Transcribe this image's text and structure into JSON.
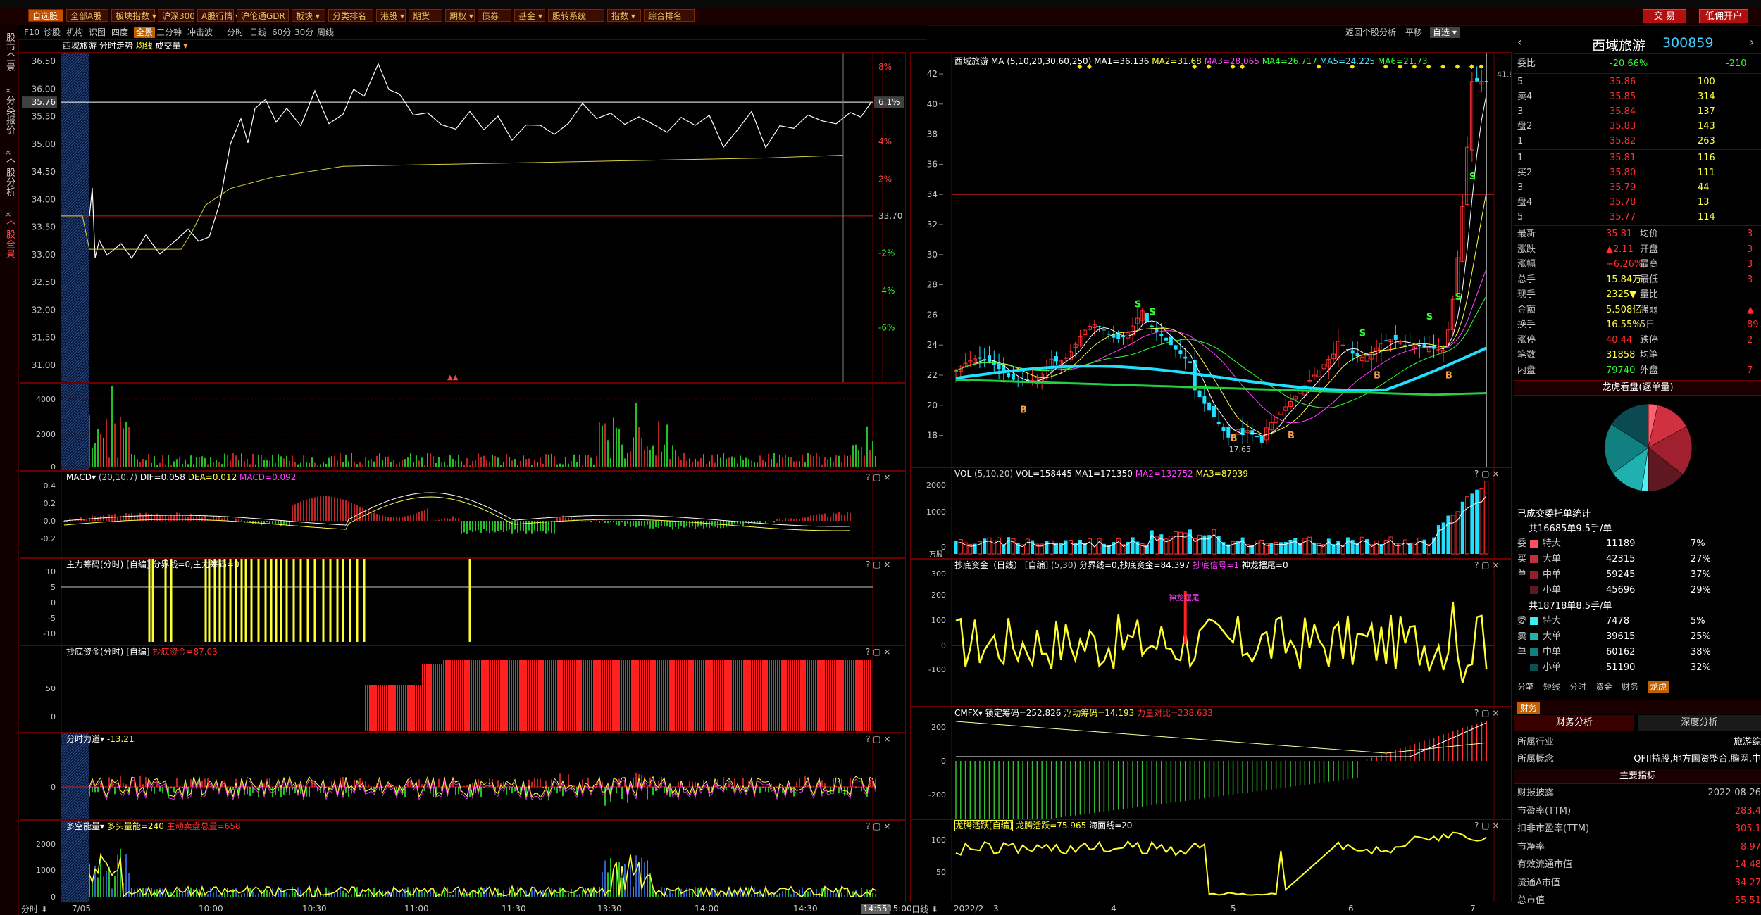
{
  "menubar": {
    "buttons": [
      "自选股",
      "全部A股",
      "板块指数",
      "沪深300",
      "A股行情",
      "沪伦通GDR",
      "板块",
      "分类排名",
      "港股",
      "期货",
      "期权",
      "债券",
      "基金",
      "股转系统",
      "指数",
      "综合排名"
    ],
    "trade_label": "交 易",
    "open_account_label": "低佣开户"
  },
  "sidebar": {
    "tabs": [
      "股市全景",
      "分类报价",
      "个股分析",
      "个股全景"
    ]
  },
  "intraday_toolbar": {
    "items": [
      "F10",
      "诊股",
      "机构",
      "识图",
      "四度",
      "全景",
      "三分钟",
      "冲击波",
      "分时",
      "日线",
      "60分",
      "30分",
      "周线"
    ],
    "active": "全景"
  },
  "kline_toolbar": {
    "items": [
      "返回个股分析",
      "平移",
      "自选"
    ]
  },
  "intraday": {
    "title_name": "西域旅游",
    "title_chart": "分时走势",
    "title_avg": "均线",
    "title_vol": "成交量",
    "price_ticks": [
      "36.50",
      "36.00",
      "35.76",
      "35.50",
      "35.00",
      "34.50",
      "34.00",
      "33.50",
      "33.00",
      "32.50",
      "32.00",
      "31.50",
      "31.00"
    ],
    "current_price": "35.76",
    "pct_ticks": [
      "8%",
      "6.1%",
      "4%",
      "2%",
      "33.70",
      "-2%",
      "-4%",
      "-6%"
    ],
    "vol_ticks": [
      "4000",
      "2000",
      "0"
    ],
    "time_labels": [
      "7/05",
      "10:00",
      "10:30",
      "11:00",
      "11:30",
      "13:30",
      "14:00",
      "14:30",
      "14:55",
      "15:00"
    ],
    "bottom_left": "分时",
    "indicators": {
      "macd": {
        "name": "MACD",
        "params": "(20,10,7)",
        "dif": "DIF=0.058",
        "dea": "DEA=0.012",
        "macd": "MACD=0.092",
        "ticks": [
          "0.4",
          "0.2",
          "0.0",
          "-0.2"
        ]
      },
      "main": {
        "name": "主力筹码(分时)",
        "custom": "[自编]",
        "line": "分界线=0,主力筹码=0",
        "ticks": [
          "10",
          "5",
          "0",
          "-5",
          "-10"
        ]
      },
      "bottom": {
        "name": "抄底资金(分时)",
        "custom": "[自编]",
        "line": "抄底资金=87.03",
        "ticks": [
          "50",
          "0"
        ]
      },
      "force": {
        "name": "分时力道",
        "value": "-13.21",
        "ticks": [
          "0"
        ]
      },
      "energy": {
        "name": "多空能量",
        "bull": "多头量能=240",
        "bear": "主动卖盘总量=658",
        "ticks": [
          "2000",
          "1000",
          "0"
        ]
      }
    }
  },
  "kline": {
    "title_name": "西域旅游",
    "ma_params": "MA (5,10,20,30,60,250)",
    "ma1": "MA1=36.136",
    "ma2": "MA2=31.68",
    "ma3": "MA3=28.065",
    "ma4": "MA4=26.717",
    "ma5": "MA5=24.225",
    "ma6": "MA6=21.73",
    "price_ticks": [
      "42",
      "40",
      "38",
      "36",
      "34",
      "32",
      "30",
      "28",
      "26",
      "24",
      "22",
      "20",
      "18"
    ],
    "high_label": "41.91",
    "low_label": "17.65",
    "date_labels": [
      "2022/2",
      "3",
      "4",
      "5",
      "6",
      "7"
    ],
    "bottom_left": "日线",
    "vol": {
      "name": "VOL",
      "params": "(5,10,20)",
      "vol": "VOL=158445",
      "ma1": "MA1=171350",
      "ma2": "MA2=132752",
      "ma3": "MA3=87939",
      "ticks": [
        "2000",
        "1000",
        "0",
        "万股"
      ]
    },
    "bottom_fund": {
      "name": "抄底资金（日线）",
      "custom": "[自编]",
      "params": "(5,30)",
      "line": "分界线=0,抄底资金=84.397",
      "signal": "抄底信号=1",
      "dragon": "神龙摆尾=0",
      "annotation": "神龙摆尾",
      "ticks": [
        "300",
        "200",
        "100",
        "0",
        "-100"
      ]
    },
    "cmfx": {
      "name": "CMFX",
      "lock": "锁定筹码=252.826",
      "float": "浮动筹码=14.193",
      "ratio": "力量对比=238.633",
      "ticks": [
        "200",
        "0",
        "-200"
      ]
    },
    "dragon": {
      "name": "龙腾活跃[自编]",
      "active": "龙腾活跃=75.965",
      "sea": "海面线=20",
      "ticks": [
        "100",
        "50"
      ]
    }
  },
  "quote": {
    "name": "西域旅游",
    "code": "300859",
    "weibi_label": "委比",
    "weibi_value": "-20.66%",
    "weicha_value": "-210",
    "sell": [
      {
        "label": "5",
        "price": "35.86",
        "vol": "100"
      },
      {
        "label": "卖4",
        "price": "35.85",
        "vol": "314"
      },
      {
        "label": "3",
        "price": "35.84",
        "vol": "137"
      },
      {
        "label": "盘2",
        "price": "35.83",
        "vol": "143"
      },
      {
        "label": "1",
        "price": "35.82",
        "vol": "263"
      }
    ],
    "buy": [
      {
        "label": "1",
        "price": "35.81",
        "vol": "116"
      },
      {
        "label": "买2",
        "price": "35.80",
        "vol": "111"
      },
      {
        "label": "3",
        "price": "35.79",
        "vol": "44"
      },
      {
        "label": "盘4",
        "price": "35.78",
        "vol": "13"
      },
      {
        "label": "5",
        "price": "35.77",
        "vol": "114"
      }
    ],
    "stats": [
      {
        "l1": "最新",
        "v1": "35.81",
        "l2": "均价",
        "v2": "3"
      },
      {
        "l1": "涨跌",
        "v1": "▲2.11",
        "l2": "开盘",
        "v2": "3"
      },
      {
        "l1": "涨幅",
        "v1": "+6.26%",
        "l2": "最高",
        "v2": "3"
      },
      {
        "l1": "总手",
        "v1": "15.84万",
        "l2": "最低",
        "v2": "3"
      },
      {
        "l1": "现手",
        "v1": "2325▼",
        "l2": "量比",
        "v2": ""
      },
      {
        "l1": "金额",
        "v1": "5.508亿",
        "l2": "强弱",
        "v2": "▲"
      },
      {
        "l1": "换手",
        "v1": "16.55%",
        "l2": "5日",
        "v2": "89."
      },
      {
        "l1": "涨停",
        "v1": "40.44",
        "l2": "跌停",
        "v2": "2"
      },
      {
        "l1": "笔数",
        "v1": "31858",
        "l2": "均笔",
        "v2": ""
      },
      {
        "l1": "内盘",
        "v1": "79740",
        "l2": "外盘",
        "v2": "7"
      }
    ],
    "pie_title": "龙虎看盘(逐单量)",
    "pie_slices": [
      {
        "v": 7,
        "c": "#ff6070"
      },
      {
        "v": 27,
        "c": "#d03040"
      },
      {
        "v": 37,
        "c": "#a02030"
      },
      {
        "v": 29,
        "c": "#601820"
      },
      {
        "v": 5,
        "c": "#50f0f0"
      },
      {
        "v": 25,
        "c": "#20b0b0"
      },
      {
        "v": 38,
        "c": "#108080"
      },
      {
        "v": 32,
        "c": "#0a4a50"
      }
    ],
    "entrust_title": "已成交委托单统计",
    "sell_total": "共16685单9.5手/单",
    "buy_total": "共18718单8.5手/单",
    "sell_rows": [
      {
        "side": "委",
        "name": "特大",
        "vol": "11189",
        "pct": "7%"
      },
      {
        "side": "买",
        "name": "大单",
        "vol": "42315",
        "pct": "27%"
      },
      {
        "side": "单",
        "name": "中单",
        "vol": "59245",
        "pct": "37%"
      },
      {
        "side": "",
        "name": "小单",
        "vol": "45696",
        "pct": "29%"
      }
    ],
    "buy_rows": [
      {
        "side": "委",
        "name": "特大",
        "vol": "7478",
        "pct": "5%"
      },
      {
        "side": "卖",
        "name": "大单",
        "vol": "39615",
        "pct": "25%"
      },
      {
        "side": "单",
        "name": "中单",
        "vol": "60162",
        "pct": "38%"
      },
      {
        "side": "",
        "name": "小单",
        "vol": "51190",
        "pct": "32%"
      }
    ],
    "bottom_tabs": [
      "分笔",
      "短线",
      "分时",
      "资金",
      "财务",
      "龙虎"
    ],
    "active_tab": "龙虎",
    "fin_tab": "财务",
    "fin_analysis": "财务分析",
    "deep_analysis": "深度分析",
    "industry_label": "所属行业",
    "industry_value": "旅游综",
    "concept_label": "所属概念",
    "concept_value": "QFII持股,地方国资整合,腾网,中",
    "main_index": "主要指标",
    "fin_rows": [
      {
        "l": "财报披露",
        "v": "2022-08-26"
      },
      {
        "l": "市盈率(TTM)",
        "v": "283.4"
      },
      {
        "l": "扣非市盈率(TTM)",
        "v": "305.1"
      },
      {
        "l": "市净率",
        "v": "8.97"
      },
      {
        "l": "有效流通市值",
        "v": "14.48"
      },
      {
        "l": "流通A市值",
        "v": "34.27"
      },
      {
        "l": "总市值",
        "v": "55.51"
      }
    ]
  }
}
